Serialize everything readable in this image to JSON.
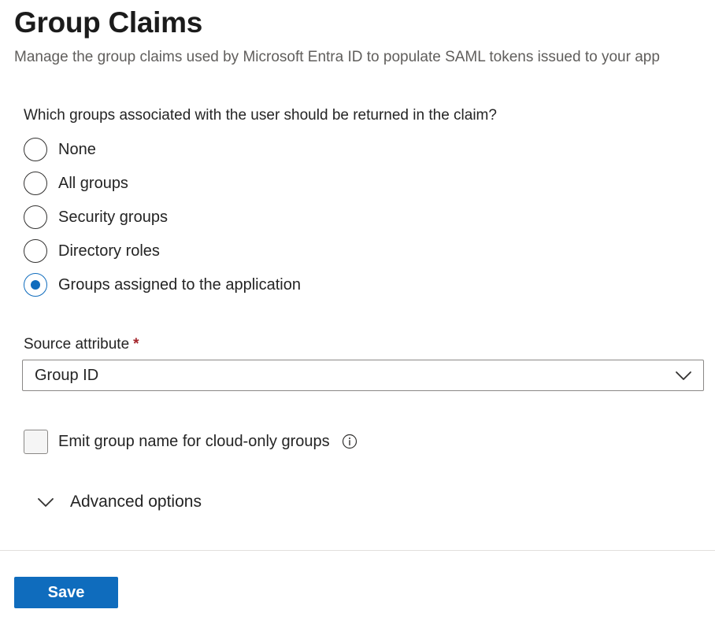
{
  "header": {
    "title": "Group Claims",
    "subtitle": "Manage the group claims used by Microsoft Entra ID to populate SAML tokens issued to your app"
  },
  "group_question": {
    "label": "Which groups associated with the user should be returned in the claim?",
    "options": [
      {
        "label": "None",
        "checked": false
      },
      {
        "label": "All groups",
        "checked": false
      },
      {
        "label": "Security groups",
        "checked": false
      },
      {
        "label": "Directory roles",
        "checked": false
      },
      {
        "label": "Groups assigned to the application",
        "checked": true
      }
    ]
  },
  "source_attribute": {
    "label": "Source attribute",
    "required_marker": "*",
    "value": "Group ID",
    "icon": "chevron-down-icon"
  },
  "emit_group_name": {
    "label": "Emit group name for cloud-only groups",
    "checked": false,
    "icon": "info-icon"
  },
  "advanced_options": {
    "label": "Advanced options",
    "expanded": false,
    "icon": "chevron-down-icon"
  },
  "footer": {
    "save_label": "Save"
  },
  "colors": {
    "accent": "#0f6cbd",
    "required": "#a4262c",
    "text": "#242424",
    "subtle_text": "#605e5c"
  }
}
